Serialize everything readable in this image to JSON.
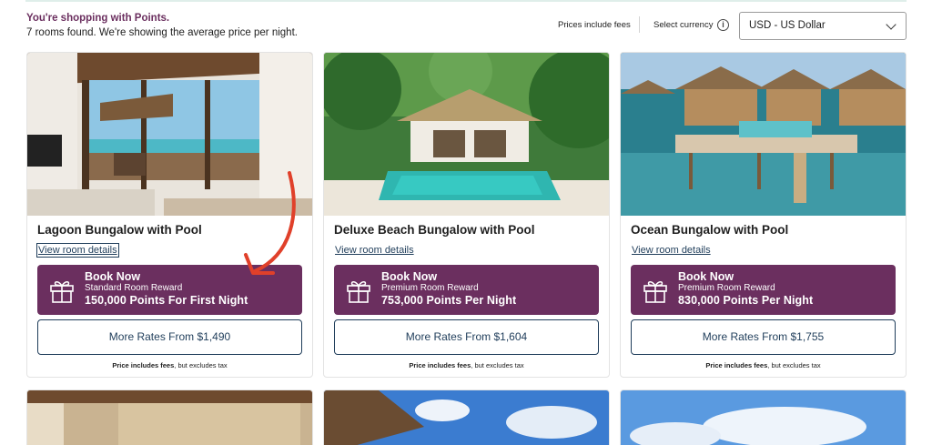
{
  "header": {
    "points_message": "You're shopping with Points.",
    "rooms_message": "7 rooms found. We're showing the average price per night.",
    "fees_note": "Prices include fees",
    "currency_label": "Select currency",
    "currency_value": "USD - US Dollar"
  },
  "rooms": [
    {
      "title": "Lagoon Bungalow with Pool",
      "details_link": "View room details",
      "book_now": "Book Now",
      "reward_type": "Standard Room Reward",
      "reward_points": "150,000 Points For First Night",
      "more_rates": "More Rates From $1,490",
      "price_note_bold": "Price includes fees",
      "price_note_rest": ", but excludes tax"
    },
    {
      "title": "Deluxe Beach Bungalow with Pool",
      "details_link": "View room details",
      "book_now": "Book Now",
      "reward_type": "Premium Room Reward",
      "reward_points": "753,000 Points Per Night",
      "more_rates": "More Rates From $1,604",
      "price_note_bold": "Price includes fees",
      "price_note_rest": ", but excludes tax"
    },
    {
      "title": "Ocean Bungalow with Pool",
      "details_link": "View room details",
      "book_now": "Book Now",
      "reward_type": "Premium Room Reward",
      "reward_points": "830,000 Points Per Night",
      "more_rates": "More Rates From $1,755",
      "price_note_bold": "Price includes fees",
      "price_note_rest": ", but excludes tax"
    }
  ],
  "colors": {
    "brand_purple": "#6b2f5f",
    "link_navy": "#1f3d5a",
    "annotation_red": "#e0402a"
  },
  "icons": [
    "info-icon",
    "chevron-down-icon",
    "gift-icon"
  ]
}
